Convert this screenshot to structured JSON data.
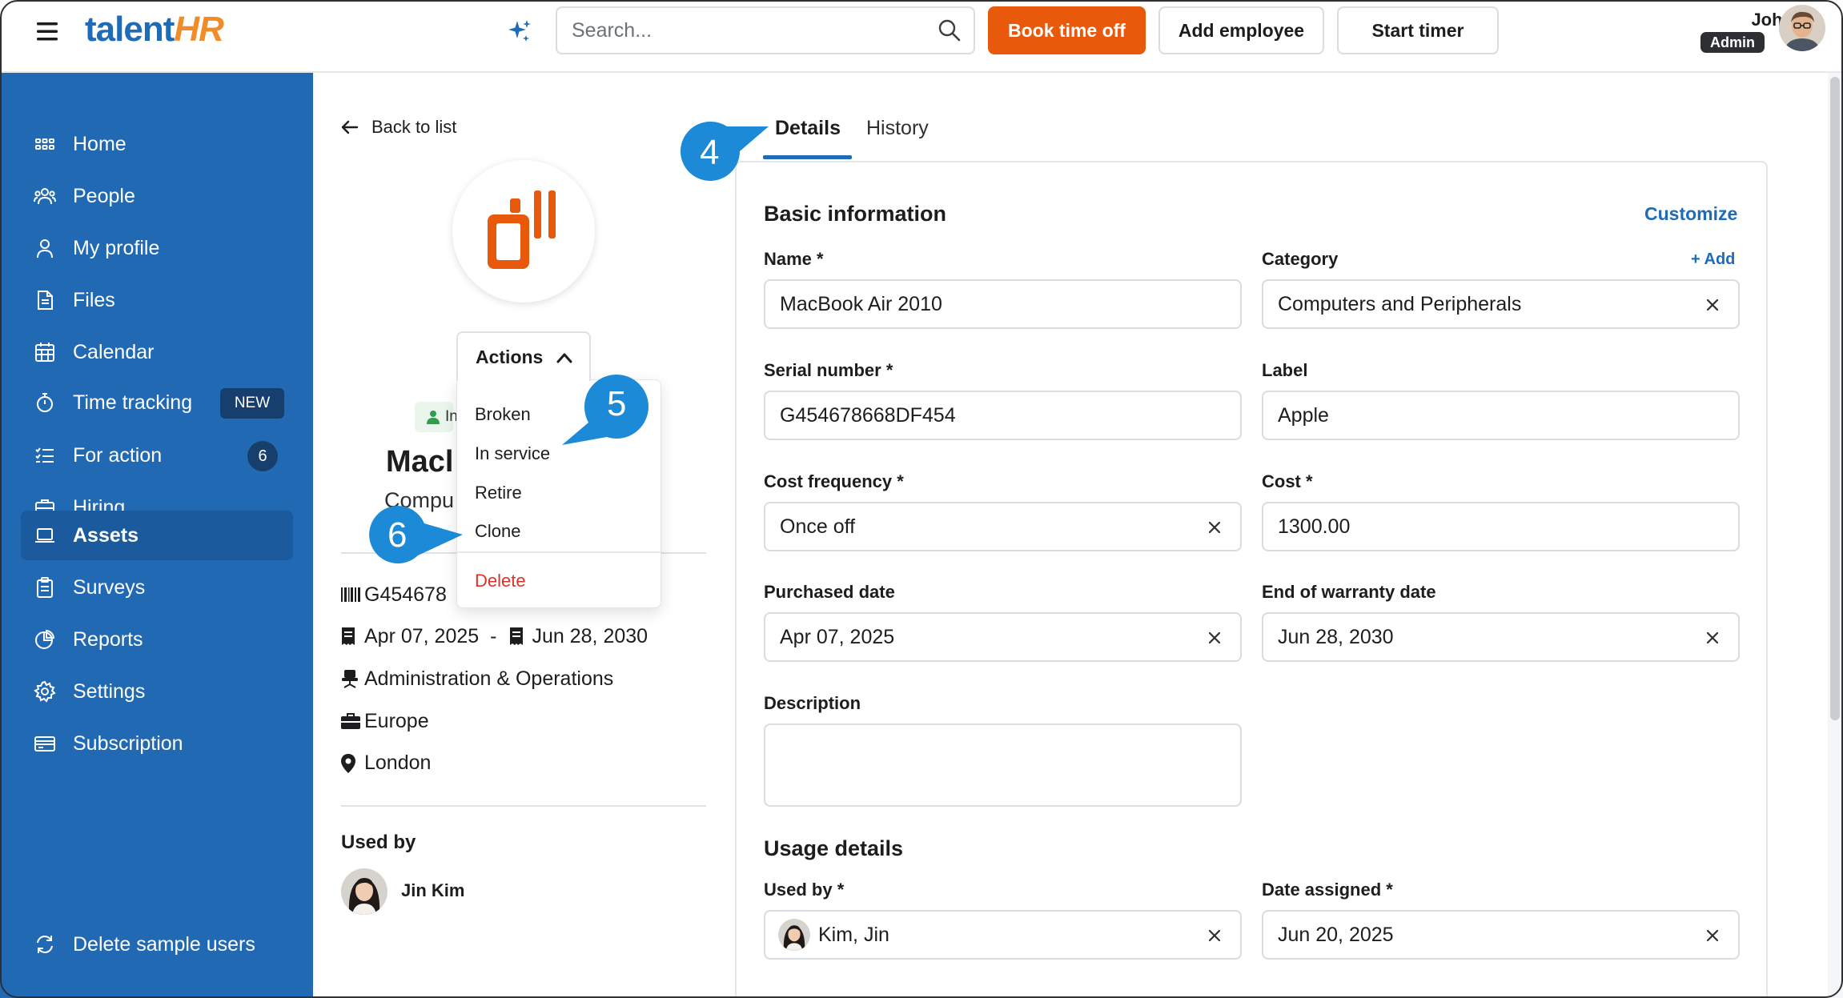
{
  "brand": {
    "logo_part1": "talent",
    "logo_part2": "HR"
  },
  "topbar": {
    "search_placeholder": "Search...",
    "book_time_off": "Book time off",
    "add_employee": "Add employee",
    "start_timer": "Start timer",
    "user_name": "John",
    "user_role": "Admin",
    "accent_color": "#e8590c"
  },
  "sidebar": {
    "color": "#2169b3",
    "items": [
      {
        "label": "Home",
        "icon": "grid-icon"
      },
      {
        "label": "People",
        "icon": "people-icon"
      },
      {
        "label": "My profile",
        "icon": "user-icon"
      },
      {
        "label": "Files",
        "icon": "file-icon"
      },
      {
        "label": "Calendar",
        "icon": "calendar-icon"
      },
      {
        "label": "Time tracking",
        "icon": "stopwatch-icon",
        "badge": "NEW"
      },
      {
        "label": "For action",
        "icon": "checklist-icon",
        "count": "6"
      },
      {
        "label": "Hiring",
        "icon": "briefcase-icon"
      },
      {
        "label": "Assets",
        "icon": "laptop-icon",
        "active": true
      },
      {
        "label": "Surveys",
        "icon": "clipboard-icon"
      },
      {
        "label": "Reports",
        "icon": "pie-chart-icon"
      },
      {
        "label": "Settings",
        "icon": "gear-icon"
      },
      {
        "label": "Subscription",
        "icon": "card-icon"
      }
    ],
    "footer_label": "Delete sample users"
  },
  "asset": {
    "back_label": "Back to list",
    "actions_label": "Actions",
    "menu": [
      "Broken",
      "In service",
      "Retire",
      "Clone"
    ],
    "delete_label": "Delete",
    "status_partial": "In",
    "title_partial": "Macl",
    "subtitle_partial": "Compu",
    "serial_partial": "G454678",
    "purchased": "Apr 07, 2025",
    "dash": "-",
    "warranty": "Jun 28, 2030",
    "department": "Administration & Operations",
    "division": "Europe",
    "location": "London",
    "used_by_heading": "Used by",
    "used_by_name": "Jin Kim"
  },
  "tabs": {
    "details": "Details",
    "history": "History"
  },
  "form": {
    "basic_heading": "Basic information",
    "customize": "Customize",
    "name_label": "Name *",
    "name_value": "MacBook Air 2010",
    "category_label": "Category",
    "add_label": "+ Add",
    "category_value": "Computers and Peripherals",
    "serial_label": "Serial number *",
    "serial_value": "G454678668DF454",
    "label_label": "Label",
    "label_value": "Apple",
    "cost_freq_label": "Cost frequency *",
    "cost_freq_value": "Once off",
    "cost_label": "Cost *",
    "cost_value": "1300.00",
    "purchased_label": "Purchased date",
    "purchased_value": "Apr 07, 2025",
    "warranty_label": "End of warranty date",
    "warranty_value": "Jun 28, 2030",
    "description_label": "Description",
    "description_value": "",
    "usage_heading": "Usage details",
    "used_by_label": "Used by *",
    "used_by_value": "Kim, Jin",
    "date_assigned_label": "Date assigned *",
    "date_assigned_value": "Jun 20, 2025"
  },
  "callouts": {
    "c4": "4",
    "c5": "5",
    "c6": "6",
    "color": "#1c8ad6"
  }
}
